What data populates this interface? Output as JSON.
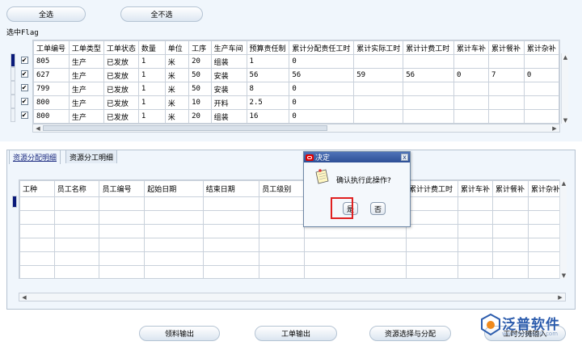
{
  "top": {
    "select_all": "全选",
    "deselect_all": "全不选",
    "flag_label": "选中Flag",
    "columns": [
      "工单编号",
      "工单类型",
      "工单状态",
      "数量",
      "单位",
      "工序",
      "生产车间",
      "预算责任制",
      "累计分配责任工时",
      "累计实际工时",
      "累计计费工时",
      "累计车补",
      "累计餐补",
      "累计杂补"
    ],
    "rows": [
      [
        "805",
        "生产",
        "已发放",
        "1",
        "米",
        "20",
        "组装",
        "1",
        "0",
        "",
        "",
        "",
        "",
        ""
      ],
      [
        "627",
        "生产",
        "已发放",
        "1",
        "米",
        "50",
        "安装",
        "56",
        "56",
        "59",
        "56",
        "0",
        "7",
        "0"
      ],
      [
        "799",
        "生产",
        "已发放",
        "1",
        "米",
        "50",
        "安装",
        "8",
        "0",
        "",
        "",
        "",
        "",
        ""
      ],
      [
        "800",
        "生产",
        "已发放",
        "1",
        "米",
        "10",
        "开料",
        "2.5",
        "0",
        "",
        "",
        "",
        "",
        ""
      ],
      [
        "800",
        "生产",
        "已发放",
        "1",
        "米",
        "20",
        "组装",
        "16",
        "0",
        "",
        "",
        "",
        "",
        ""
      ]
    ],
    "checked": [
      "✔",
      "✔",
      "✔",
      "✔",
      "✔"
    ]
  },
  "bottom": {
    "tabs": [
      "资源分配明细",
      "资源分工明细"
    ],
    "columns_left": [
      "工种",
      "员工名称",
      "员工编号",
      "起始日期",
      "结束日期",
      "员工级别"
    ],
    "columns_right": [
      "累计计费工时",
      "累计车补",
      "累计餐补",
      "累计杂补"
    ]
  },
  "dialog": {
    "title": "决定",
    "message": "确认执行此操作?",
    "yes": "是",
    "no": "否",
    "close_glyph": "x"
  },
  "actions": {
    "issue_output": "领料输出",
    "workorder_output": "工单输出",
    "resource_select": "资源选择与分配",
    "hours_input": "工时分摊输入"
  },
  "brand": {
    "name": "泛普软件",
    "url": "www.fanpusoft.com"
  }
}
